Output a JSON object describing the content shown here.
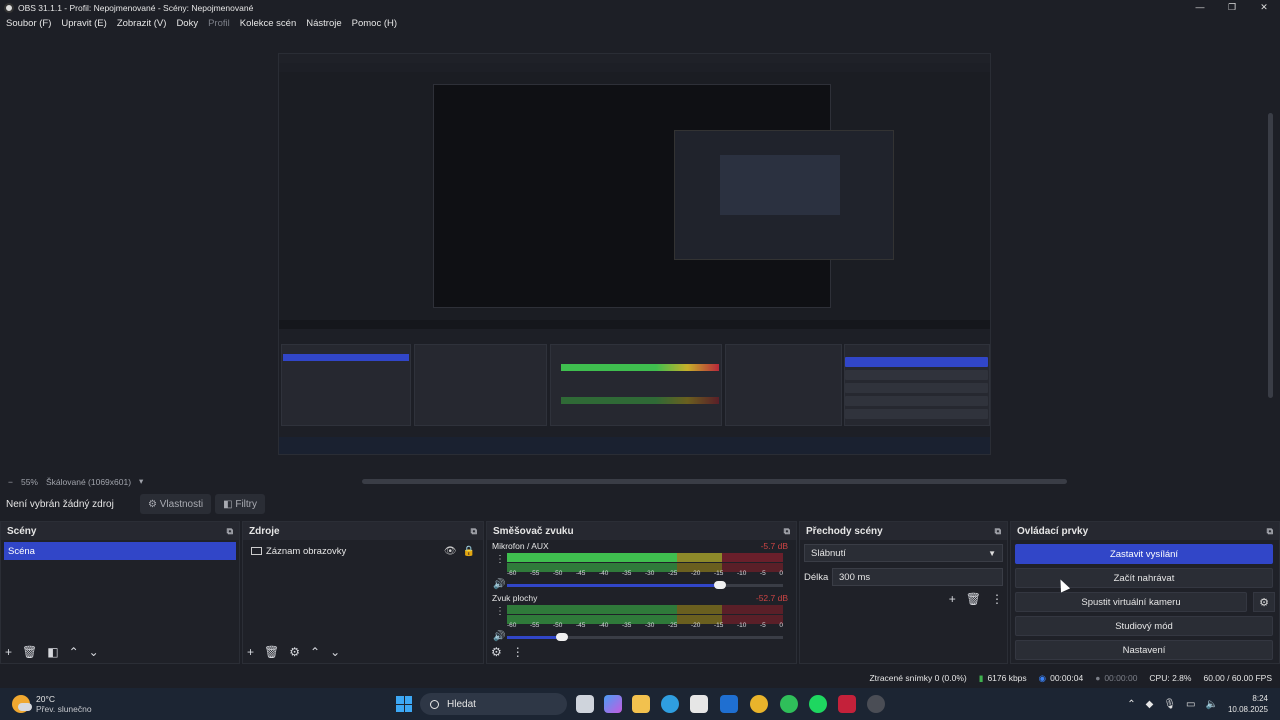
{
  "window": {
    "title": "OBS 31.1.1 - Profil: Nepojmenované - Scény: Nepojmenované",
    "controls": [
      "—",
      "❐",
      "✕"
    ]
  },
  "menu": [
    "Soubor (F)",
    "Upravit (E)",
    "Zobrazit (V)",
    "Doky",
    "Profil",
    "Kolekce scén",
    "Nástroje",
    "Pomoc (H)"
  ],
  "preview": {
    "zoom": "55%",
    "scale_mode": "Škálované (1069x601)"
  },
  "source_toolbar": {
    "no_selection": "Není vybrán žádný zdroj",
    "properties": "Vlastnosti",
    "filters": "Filtry"
  },
  "docks": {
    "scenes": {
      "title": "Scény",
      "items": [
        "Scéna"
      ]
    },
    "sources": {
      "title": "Zdroje",
      "items": [
        "Záznam obrazovky"
      ]
    },
    "mixer": {
      "title": "Směšovač zvuku",
      "tracks": [
        {
          "name": "Mikrofon / AUX",
          "db": "-5.7 dB",
          "volume": 0.77
        },
        {
          "name": "Zvuk plochy",
          "db": "-52.7 dB",
          "volume": 0.2
        }
      ],
      "ticks": [
        "-60",
        "-55",
        "-50",
        "-45",
        "-40",
        "-35",
        "-30",
        "-25",
        "-20",
        "-15",
        "-10",
        "-5",
        "0"
      ]
    },
    "transitions": {
      "title": "Přechody scény",
      "selected": "Slábnutí",
      "duration_label": "Délka",
      "duration_value": "300 ms"
    },
    "controls": {
      "title": "Ovládací prvky",
      "stop_stream": "Zastavit vysílání",
      "start_record": "Začít nahrávat",
      "virtual_cam": "Spustit virtuální kameru",
      "studio_mode": "Studiový mód",
      "settings": "Nastavení"
    }
  },
  "status": {
    "dropped": "Ztracené snímky 0 (0.0%)",
    "bitrate": "6176 kbps",
    "stream_time": "00:00:04",
    "record_time": "00:00:00",
    "cpu": "CPU: 2.8%",
    "fps": "60.00 / 60.00 FPS"
  },
  "taskbar": {
    "weather_temp": "20°C",
    "weather_desc": "Přev. slunečno",
    "search": "Hledat",
    "time": "8:24",
    "date": "10.08.2025"
  },
  "colors": {
    "accent": "#3146c8",
    "meter_green": "#3fbf4f",
    "meter_yellow": "#c7b02a",
    "meter_red": "#b8283a"
  }
}
